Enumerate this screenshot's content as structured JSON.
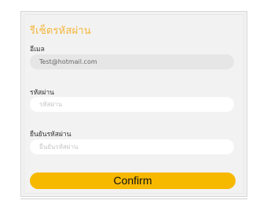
{
  "form": {
    "title": "รีเซ็ตรหัสผ่าน",
    "email_label": "อีเมล",
    "email_value": "Test@hotmail.com",
    "password_label": "รหัสผ่าน",
    "password_placeholder": "รหัสผ่าน",
    "confirm_password_label": "ยืนยันรหัสผ่าน",
    "confirm_password_placeholder": "ยืนยันรหัสผ่าน",
    "confirm_button": "Confirm"
  },
  "colors": {
    "accent": "#f7b800",
    "title": "#f4b63a",
    "panel": "#f2f2f2"
  }
}
